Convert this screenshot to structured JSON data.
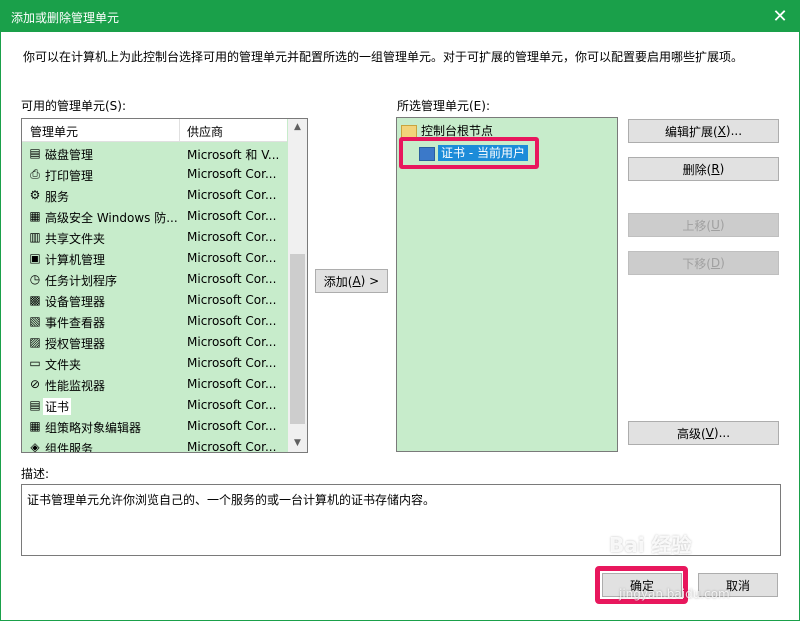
{
  "window": {
    "title": "添加或删除管理单元",
    "close_glyph": "✕"
  },
  "instructions": "你可以在计算机上为此控制台选择可用的管理单元并配置所选的一组管理单元。对于可扩展的管理单元，你可以配置要启用哪些扩展项。",
  "available": {
    "label": "可用的管理单元(S):",
    "columns": [
      "管理单元",
      "供应商"
    ],
    "rows": [
      {
        "icon": "disk-icon",
        "glyph": "▤",
        "name": "磁盘管理",
        "vendor": "Microsoft 和 V..."
      },
      {
        "icon": "printer-icon",
        "glyph": "⎙",
        "name": "打印管理",
        "vendor": "Microsoft Cor..."
      },
      {
        "icon": "gear-icon",
        "glyph": "⚙",
        "name": "服务",
        "vendor": "Microsoft Cor..."
      },
      {
        "icon": "firewall-icon",
        "glyph": "▦",
        "name": "高级安全 Windows 防...",
        "vendor": "Microsoft Cor..."
      },
      {
        "icon": "shared-folder-icon",
        "glyph": "▥",
        "name": "共享文件夹",
        "vendor": "Microsoft Cor..."
      },
      {
        "icon": "computer-icon",
        "glyph": "▣",
        "name": "计算机管理",
        "vendor": "Microsoft Cor..."
      },
      {
        "icon": "clock-icon",
        "glyph": "◷",
        "name": "任务计划程序",
        "vendor": "Microsoft Cor..."
      },
      {
        "icon": "device-icon",
        "glyph": "▩",
        "name": "设备管理器",
        "vendor": "Microsoft Cor..."
      },
      {
        "icon": "event-viewer-icon",
        "glyph": "▧",
        "name": "事件查看器",
        "vendor": "Microsoft Cor..."
      },
      {
        "icon": "authorization-icon",
        "glyph": "▨",
        "name": "授权管理器",
        "vendor": "Microsoft Cor..."
      },
      {
        "icon": "folder-icon",
        "glyph": "▭",
        "name": "文件夹",
        "vendor": "Microsoft Cor..."
      },
      {
        "icon": "performance-icon",
        "glyph": "⊘",
        "name": "性能监视器",
        "vendor": "Microsoft Cor..."
      },
      {
        "icon": "certificate-icon",
        "glyph": "▤",
        "name": "证书",
        "vendor": "Microsoft Cor..."
      },
      {
        "icon": "policy-editor-icon",
        "glyph": "▦",
        "name": "组策略对象编辑器",
        "vendor": "Microsoft Cor..."
      },
      {
        "icon": "component-icon",
        "glyph": "◈",
        "name": "组件服务",
        "vendor": "Microsoft Cor..."
      }
    ]
  },
  "add_button": {
    "prefix": "添加(",
    "key": "A",
    "suffix": ") >"
  },
  "selected": {
    "label": "所选管理单元(E):",
    "root": "控制台根节点",
    "child": "证书 - 当前用户"
  },
  "side_buttons": {
    "edit_ext": {
      "prefix": "编辑扩展(",
      "key": "X",
      "suffix": ")..."
    },
    "remove": {
      "prefix": "删除(",
      "key": "R",
      "suffix": ")"
    },
    "move_up": {
      "prefix": "上移(",
      "key": "U",
      "suffix": ")"
    },
    "move_down": {
      "prefix": "下移(",
      "key": "D",
      "suffix": ")"
    },
    "advanced": {
      "prefix": "高级(",
      "key": "V",
      "suffix": ")..."
    }
  },
  "description": {
    "label": "描述:",
    "text": "证书管理单元允许你浏览自己的、一个服务的或一台计算机的证书存储内容。"
  },
  "footer": {
    "ok": "确定",
    "cancel": "取消"
  },
  "watermark": {
    "main": "Bai 经验",
    "sub": "jingyan.baidu.com"
  }
}
